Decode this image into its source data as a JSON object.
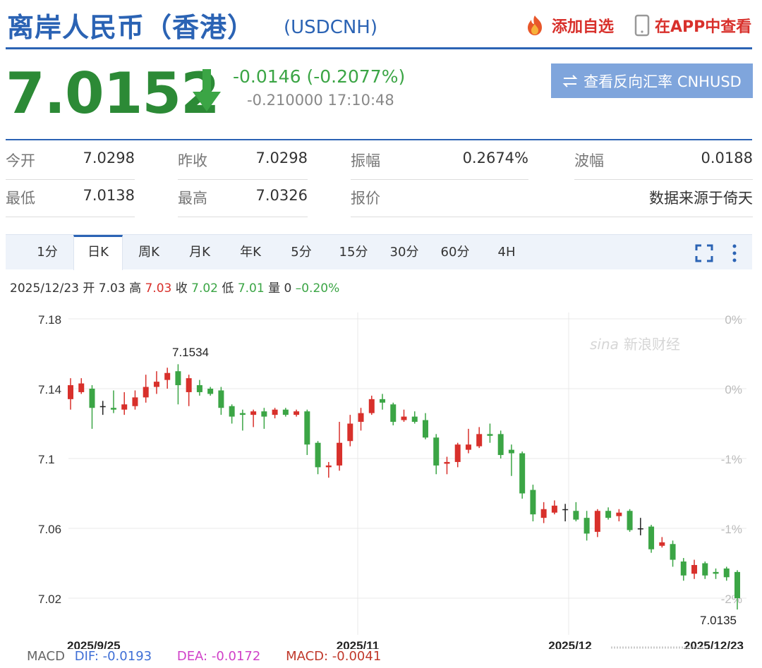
{
  "header": {
    "title": "离岸人民币（香港）",
    "code": "(USDCNH)",
    "add_label": "添加自选",
    "app_label": "在APP中查看"
  },
  "quote": {
    "price": "7.0152",
    "change": "-0.0146 (-0.2077%)",
    "sub": "-0.210000 17:10:48",
    "reverse_label": "查看反向汇率 CNHUSD",
    "direction": "down",
    "down_color": "#2c8a36"
  },
  "stats": {
    "open_label": "今开",
    "open": "7.0298",
    "prev_label": "昨收",
    "prev": "7.0298",
    "amp_label": "振幅",
    "amp": "0.2674%",
    "wave_label": "波幅",
    "wave": "0.0188",
    "low_label": "最低",
    "low": "7.0138",
    "high_label": "最高",
    "high": "7.0326",
    "quote_label": "报价",
    "source": "数据来源于倚天"
  },
  "tabs": [
    "1分",
    "日K",
    "周K",
    "月K",
    "年K",
    "5分",
    "15分",
    "30分",
    "60分",
    "4H"
  ],
  "active_tab": "日K",
  "ohlc": {
    "date": "2025/12/23",
    "open_label": "开",
    "open": "7.03",
    "high_label": "高",
    "high": "7.03",
    "close_label": "收",
    "close": "7.02",
    "low_label": "低",
    "low": "7.01",
    "vol_label": "量",
    "vol": "0",
    "pct": "–0.20%"
  },
  "chart_data": {
    "type": "candlestick",
    "y_ticks": [
      "7.18",
      "7.14",
      "7.1",
      "7.06",
      "7.02"
    ],
    "y_range": [
      7.0,
      7.18
    ],
    "pct_ticks": [
      "0%",
      "0%",
      "-1%",
      "-1%",
      "-2%"
    ],
    "x_ticks": [
      "2025/9/25",
      "2025/11",
      "2025/12",
      "2025/12/23"
    ],
    "max_label": "7.1534",
    "last_label": "7.0135",
    "watermark": "新浪财经",
    "up_color": "#d8302b",
    "down_color": "#3ba545",
    "candles": [
      {
        "o": 7.134,
        "c": 7.142,
        "h": 7.146,
        "l": 7.128
      },
      {
        "o": 7.138,
        "c": 7.143,
        "h": 7.146,
        "l": 7.137
      },
      {
        "o": 7.14,
        "c": 7.129,
        "h": 7.142,
        "l": 7.117
      },
      {
        "o": 7.13,
        "c": 7.13,
        "h": 7.133,
        "l": 7.125
      },
      {
        "o": 7.129,
        "c": 7.128,
        "h": 7.139,
        "l": 7.126
      },
      {
        "o": 7.128,
        "c": 7.131,
        "h": 7.138,
        "l": 7.125
      },
      {
        "o": 7.13,
        "c": 7.135,
        "h": 7.139,
        "l": 7.128
      },
      {
        "o": 7.135,
        "c": 7.141,
        "h": 7.148,
        "l": 7.132
      },
      {
        "o": 7.141,
        "c": 7.144,
        "h": 7.15,
        "l": 7.137
      },
      {
        "o": 7.145,
        "c": 7.149,
        "h": 7.152,
        "l": 7.14
      },
      {
        "o": 7.15,
        "c": 7.142,
        "h": 7.154,
        "l": 7.131
      },
      {
        "o": 7.138,
        "c": 7.146,
        "h": 7.148,
        "l": 7.13
      },
      {
        "o": 7.142,
        "c": 7.138,
        "h": 7.145,
        "l": 7.136
      },
      {
        "o": 7.14,
        "c": 7.137,
        "h": 7.141,
        "l": 7.136
      },
      {
        "o": 7.139,
        "c": 7.129,
        "h": 7.141,
        "l": 7.125
      },
      {
        "o": 7.13,
        "c": 7.124,
        "h": 7.131,
        "l": 7.12
      },
      {
        "o": 7.126,
        "c": 7.125,
        "h": 7.128,
        "l": 7.116
      },
      {
        "o": 7.125,
        "c": 7.127,
        "h": 7.128,
        "l": 7.118
      },
      {
        "o": 7.127,
        "c": 7.124,
        "h": 7.129,
        "l": 7.117
      },
      {
        "o": 7.125,
        "c": 7.128,
        "h": 7.129,
        "l": 7.123
      },
      {
        "o": 7.128,
        "c": 7.125,
        "h": 7.129,
        "l": 7.124
      },
      {
        "o": 7.125,
        "c": 7.127,
        "h": 7.128,
        "l": 7.124
      },
      {
        "o": 7.127,
        "c": 7.108,
        "h": 7.128,
        "l": 7.102
      },
      {
        "o": 7.109,
        "c": 7.095,
        "h": 7.11,
        "l": 7.091
      },
      {
        "o": 7.095,
        "c": 7.096,
        "h": 7.098,
        "l": 7.089
      },
      {
        "o": 7.096,
        "c": 7.109,
        "h": 7.121,
        "l": 7.093
      },
      {
        "o": 7.11,
        "c": 7.12,
        "h": 7.125,
        "l": 7.107
      },
      {
        "o": 7.121,
        "c": 7.126,
        "h": 7.129,
        "l": 7.116
      },
      {
        "o": 7.126,
        "c": 7.134,
        "h": 7.136,
        "l": 7.125
      },
      {
        "o": 7.134,
        "c": 7.132,
        "h": 7.137,
        "l": 7.128
      },
      {
        "o": 7.131,
        "c": 7.121,
        "h": 7.132,
        "l": 7.119
      },
      {
        "o": 7.122,
        "c": 7.124,
        "h": 7.128,
        "l": 7.121
      },
      {
        "o": 7.124,
        "c": 7.121,
        "h": 7.127,
        "l": 7.12
      },
      {
        "o": 7.122,
        "c": 7.112,
        "h": 7.126,
        "l": 7.111
      },
      {
        "o": 7.112,
        "c": 7.096,
        "h": 7.114,
        "l": 7.091
      },
      {
        "o": 7.097,
        "c": 7.098,
        "h": 7.101,
        "l": 7.091
      },
      {
        "o": 7.098,
        "c": 7.108,
        "h": 7.109,
        "l": 7.095
      },
      {
        "o": 7.105,
        "c": 7.108,
        "h": 7.117,
        "l": 7.103
      },
      {
        "o": 7.107,
        "c": 7.114,
        "h": 7.118,
        "l": 7.106
      },
      {
        "o": 7.114,
        "c": 7.113,
        "h": 7.12,
        "l": 7.109
      },
      {
        "o": 7.114,
        "c": 7.102,
        "h": 7.116,
        "l": 7.1
      },
      {
        "o": 7.105,
        "c": 7.103,
        "h": 7.108,
        "l": 7.09
      },
      {
        "o": 7.103,
        "c": 7.08,
        "h": 7.104,
        "l": 7.077
      },
      {
        "o": 7.082,
        "c": 7.068,
        "h": 7.085,
        "l": 7.064
      },
      {
        "o": 7.066,
        "c": 7.071,
        "h": 7.075,
        "l": 7.063
      },
      {
        "o": 7.069,
        "c": 7.073,
        "h": 7.076,
        "l": 7.068
      },
      {
        "o": 7.071,
        "c": 7.071,
        "h": 7.074,
        "l": 7.064
      },
      {
        "o": 7.07,
        "c": 7.065,
        "h": 7.075,
        "l": 7.064
      },
      {
        "o": 7.066,
        "c": 7.057,
        "h": 7.07,
        "l": 7.053
      },
      {
        "o": 7.058,
        "c": 7.07,
        "h": 7.071,
        "l": 7.055
      },
      {
        "o": 7.07,
        "c": 7.066,
        "h": 7.072,
        "l": 7.065
      },
      {
        "o": 7.067,
        "c": 7.069,
        "h": 7.071,
        "l": 7.064
      },
      {
        "o": 7.07,
        "c": 7.059,
        "h": 7.071,
        "l": 7.058
      },
      {
        "o": 7.06,
        "c": 7.06,
        "h": 7.066,
        "l": 7.056
      },
      {
        "o": 7.061,
        "c": 7.048,
        "h": 7.062,
        "l": 7.046
      },
      {
        "o": 7.05,
        "c": 7.052,
        "h": 7.055,
        "l": 7.049
      },
      {
        "o": 7.051,
        "c": 7.042,
        "h": 7.053,
        "l": 7.038
      },
      {
        "o": 7.041,
        "c": 7.033,
        "h": 7.043,
        "l": 7.03
      },
      {
        "o": 7.034,
        "c": 7.039,
        "h": 7.042,
        "l": 7.031
      },
      {
        "o": 7.04,
        "c": 7.033,
        "h": 7.041,
        "l": 7.031
      },
      {
        "o": 7.035,
        "c": 7.034,
        "h": 7.037,
        "l": 7.031
      },
      {
        "o": 7.037,
        "c": 7.032,
        "h": 7.038,
        "l": 7.03
      },
      {
        "o": 7.035,
        "c": 7.02,
        "h": 7.036,
        "l": 7.0135
      }
    ]
  },
  "macd": {
    "label": "MACD",
    "dif": "DIF: -0.0193",
    "dea": "DEA: -0.0172",
    "value": "MACD: -0.0041"
  }
}
